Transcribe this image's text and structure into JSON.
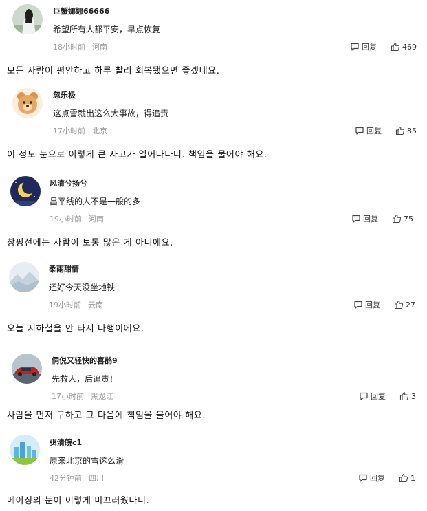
{
  "reply_label": "回复",
  "comments": [
    {
      "username": "巨蟹娜娜66666",
      "text": "希望所有人都平安，早点恢复",
      "time": "18小时前",
      "location": "河南",
      "likes": "469",
      "translation": "모든 사람이 평안하고 하루 빨리 회복됐으면 좋겠네요."
    },
    {
      "username": "忽乐极",
      "text": "这点雪就出这么大事故，得追责",
      "time": "17小时前",
      "location": "北京",
      "likes": "85",
      "translation": "이 정도 눈으로 이렇게 큰 사고가 일어나다니. 책임을 물어야 해요."
    },
    {
      "username": "风清兮扬兮",
      "text": "昌平线的人不是一般的多",
      "time": "19小时前",
      "location": "河南",
      "likes": "75",
      "translation": "창핑선에는 사람이 보통 많은 게 아니에요."
    },
    {
      "username": "柔雨甜情",
      "text": "还好今天没坐地铁",
      "time": "19小时前",
      "location": "云南",
      "likes": "27",
      "translation": "오늘 지하철을 안 타서 다행이에요."
    },
    {
      "username": "侗侻又轻快的喜鹊9",
      "text": "先救人，后追责！",
      "time": "17小时前",
      "location": "黑龙江",
      "likes": "3",
      "translation": "사람을 먼저 구하고 그 다음에 책임을 물어야 해요."
    },
    {
      "username": "弭清皖c1",
      "text": "原来北京的雪这么滑",
      "time": "42分钟前",
      "location": "四川",
      "likes": "1",
      "translation": "베이징의 눈이 이렇게 미끄러웠다니."
    }
  ]
}
